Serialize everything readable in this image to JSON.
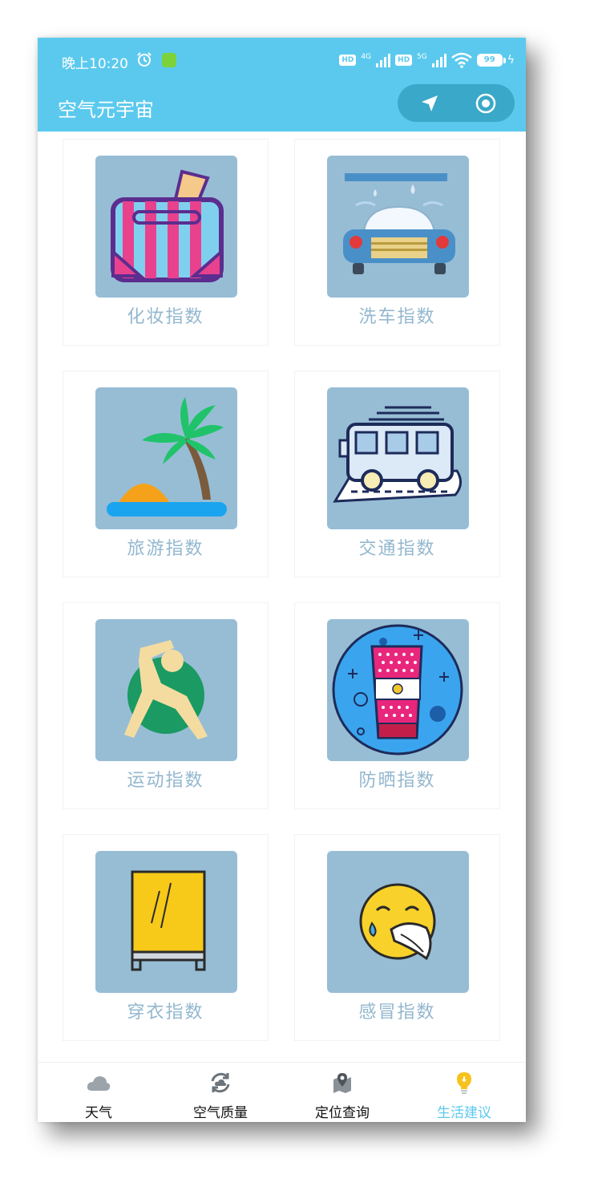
{
  "status_bar": {
    "time": "晚上10:20",
    "network_1": "4G",
    "network_2": "5G",
    "hd_badge": "HD",
    "battery": "99"
  },
  "app_bar": {
    "title": "空气元宇宙",
    "nav_icon": "navigation-arrow-icon",
    "locate_icon": "locate-target-icon"
  },
  "cards": [
    {
      "label": "化妆指数",
      "icon": "makeup-bag-icon"
    },
    {
      "label": "洗车指数",
      "icon": "car-wash-icon"
    },
    {
      "label": "旅游指数",
      "icon": "palm-beach-icon"
    },
    {
      "label": "交通指数",
      "icon": "bus-icon"
    },
    {
      "label": "运动指数",
      "icon": "exercise-icon"
    },
    {
      "label": "防晒指数",
      "icon": "sunscreen-icon"
    },
    {
      "label": "穿衣指数",
      "icon": "mirror-icon"
    },
    {
      "label": "感冒指数",
      "icon": "sneeze-face-icon"
    }
  ],
  "bottom_nav": {
    "items": [
      {
        "label": "天气",
        "icon": "cloud-icon"
      },
      {
        "label": "空气质量",
        "icon": "air-refresh-icon"
      },
      {
        "label": "定位查询",
        "icon": "map-pin-icon"
      },
      {
        "label": "生活建议",
        "icon": "lightbulb-icon"
      }
    ],
    "active_index": 3
  },
  "colors": {
    "primary": "#5bc9ee",
    "pill": "#3aa8c8",
    "tile_bg": "#97bdd5",
    "label": "#93b7cf"
  }
}
